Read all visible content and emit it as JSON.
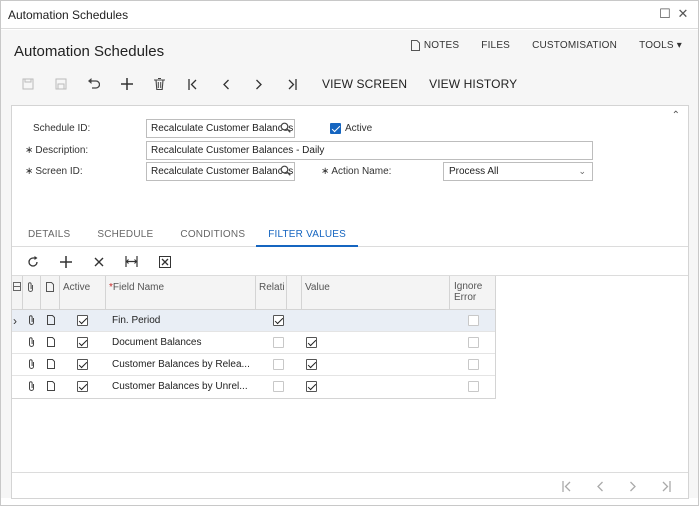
{
  "window": {
    "title": "Automation Schedules",
    "maximize_glyph": "☐",
    "close_glyph": "✕"
  },
  "page": {
    "title": "Automation Schedules",
    "links": {
      "notes": "NOTES",
      "files": "FILES",
      "customisation": "CUSTOMISATION",
      "tools": "TOOLS ▾"
    }
  },
  "toolbar": {
    "icons": [
      "save-close-icon",
      "save-icon",
      "undo-icon",
      "add-icon",
      "delete-icon",
      "first-icon",
      "previous-icon",
      "next-icon",
      "last-icon"
    ],
    "view_screen": "VIEW SCREEN",
    "view_history": "VIEW HISTORY"
  },
  "form": {
    "collapse_glyph": "⌃",
    "schedule_id_label": "Schedule ID:",
    "schedule_id_value": "Recalculate Customer Balances",
    "active_label": "Active",
    "active_checked": true,
    "description_label": "Description:",
    "description_value": "Recalculate Customer Balances - Daily",
    "screen_id_label": "Screen ID:",
    "screen_id_value": "Recalculate Customer Balances",
    "action_name_label": "Action Name:",
    "action_name_value": "Process All",
    "required_mark": "∗",
    "caret": "⌄"
  },
  "tabs": [
    "DETAILS",
    "SCHEDULE",
    "CONDITIONS",
    "FILTER VALUES"
  ],
  "active_tab": "FILTER VALUES",
  "grid": {
    "columns": {
      "active": "Active",
      "field_name": "Field Name",
      "relative": "Relati",
      "value": "Value",
      "ignore_error": "Ignore Error"
    },
    "required_mark": "*",
    "row_pointer": "›",
    "rows": [
      {
        "active": true,
        "field_name": "Fin. Period",
        "relative": true,
        "value_checked": null,
        "ignore_error": false
      },
      {
        "active": true,
        "field_name": "Document Balances",
        "relative": false,
        "value_checked": true,
        "ignore_error": false
      },
      {
        "active": true,
        "field_name": "Customer Balances by Relea...",
        "relative": false,
        "value_checked": true,
        "ignore_error": false
      },
      {
        "active": true,
        "field_name": "Customer Balances by Unrel...",
        "relative": false,
        "value_checked": true,
        "ignore_error": false
      }
    ]
  },
  "pager": [
    "first-page-icon",
    "previous-page-icon",
    "next-page-icon",
    "last-page-icon"
  ]
}
